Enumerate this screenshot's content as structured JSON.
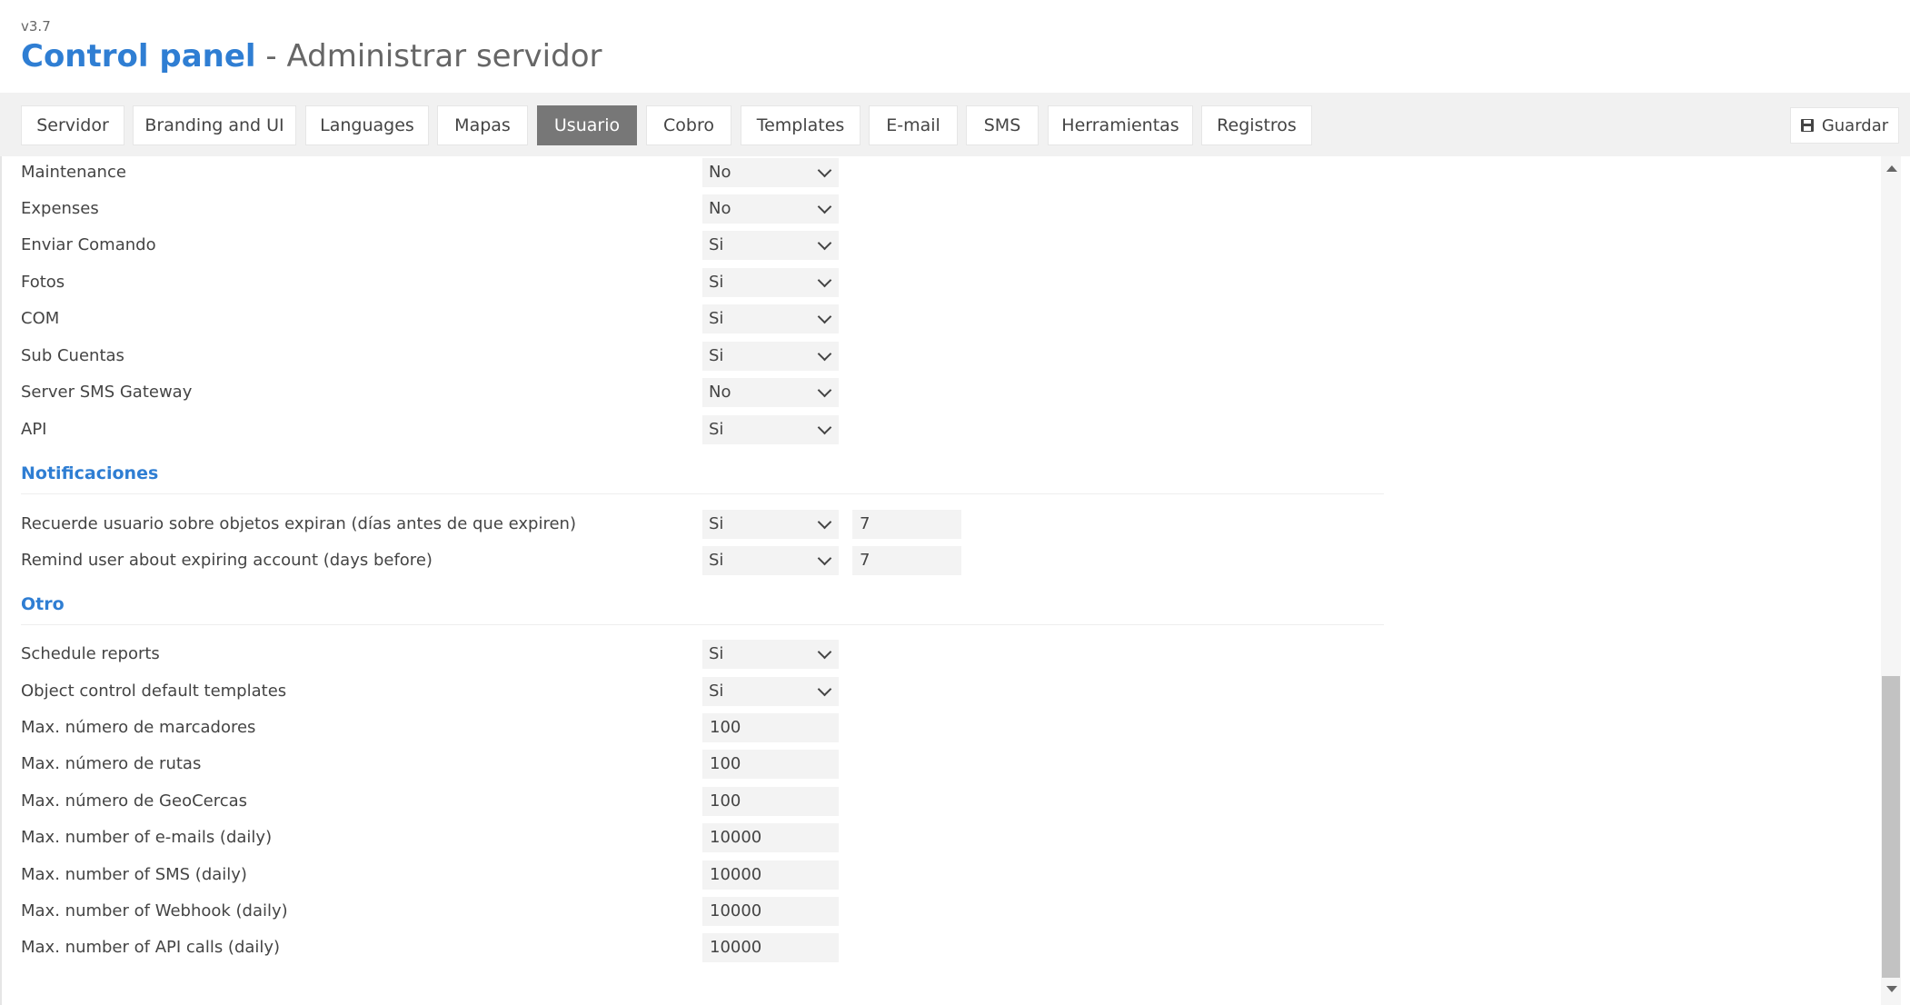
{
  "header": {
    "version": "v3.7",
    "app_title": "Control panel",
    "separator": "-",
    "subtitle": "Administrar servidor"
  },
  "tabs": [
    {
      "label": "Servidor",
      "active": false
    },
    {
      "label": "Branding and UI",
      "active": false
    },
    {
      "label": "Languages",
      "active": false
    },
    {
      "label": "Mapas",
      "active": false
    },
    {
      "label": "Usuario",
      "active": true
    },
    {
      "label": "Cobro",
      "active": false
    },
    {
      "label": "Templates",
      "active": false
    },
    {
      "label": "E-mail",
      "active": false
    },
    {
      "label": "SMS",
      "active": false
    },
    {
      "label": "Herramientas",
      "active": false
    },
    {
      "label": "Registros",
      "active": false
    }
  ],
  "toolbar": {
    "save_label": "Guardar",
    "save_icon": "floppy-disk-icon"
  },
  "permissions": {
    "rows": [
      {
        "label": "Maintenance",
        "value": "No"
      },
      {
        "label": "Expenses",
        "value": "No"
      },
      {
        "label": "Enviar Comando",
        "value": "Si"
      },
      {
        "label": "Fotos",
        "value": "Si"
      },
      {
        "label": "COM",
        "value": "Si"
      },
      {
        "label": "Sub Cuentas",
        "value": "Si"
      },
      {
        "label": "Server SMS Gateway",
        "value": "No"
      },
      {
        "label": "API",
        "value": "Si"
      }
    ]
  },
  "notifications": {
    "title": "Notificaciones",
    "rows": [
      {
        "label": "Recuerde usuario sobre objetos expiran (días antes de que expiren)",
        "value": "Si",
        "days": "7"
      },
      {
        "label": "Remind user about expiring account (days before)",
        "value": "Si",
        "days": "7"
      }
    ]
  },
  "other": {
    "title": "Otro",
    "select_rows": [
      {
        "label": "Schedule reports",
        "value": "Si"
      },
      {
        "label": "Object control default templates",
        "value": "Si"
      }
    ],
    "input_rows": [
      {
        "label": "Max. número de marcadores",
        "value": "100"
      },
      {
        "label": "Max. número de rutas",
        "value": "100"
      },
      {
        "label": "Max. número de GeoCercas",
        "value": "100"
      },
      {
        "label": "Max. number of e-mails (daily)",
        "value": "10000"
      },
      {
        "label": "Max. number of SMS (daily)",
        "value": "10000"
      },
      {
        "label": "Max. number of Webhook (daily)",
        "value": "10000"
      },
      {
        "label": "Max. number of API calls (daily)",
        "value": "10000"
      }
    ]
  },
  "colors": {
    "accent": "#2f7ed3",
    "active_tab": "#777777",
    "tabbar_bg": "#f1f1f1",
    "field_bg": "#f3f3f3"
  }
}
